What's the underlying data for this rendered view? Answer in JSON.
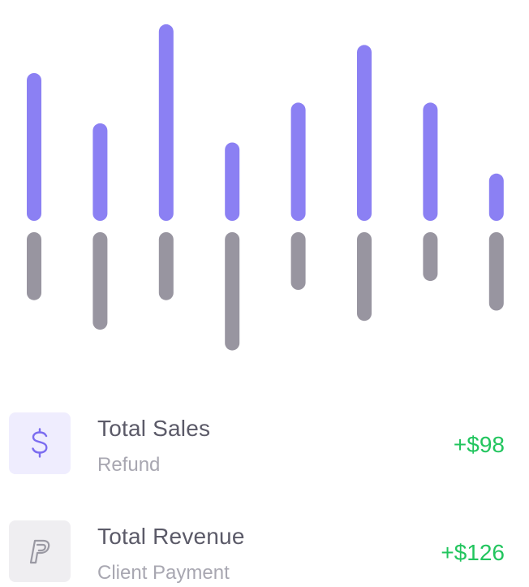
{
  "chart_data": {
    "type": "bar",
    "categories": [
      "",
      "",
      "",
      "",
      "",
      "",
      "",
      ""
    ],
    "series": [
      {
        "values": [
          100,
          66,
          133,
          53,
          80,
          119,
          80,
          32
        ],
        "color": "#8b80f3"
      },
      {
        "values": [
          -46,
          -66,
          -46,
          -80,
          -39,
          -60,
          -33,
          -53
        ],
        "color": "#9895a0"
      }
    ],
    "ylim": [
      -80,
      133
    ],
    "grid": false,
    "legend": "none"
  },
  "transactions": [
    {
      "title": "Total Sales",
      "subtitle": "Refund",
      "amount": "+$98",
      "icon": "dollar-icon",
      "icon_color": "#7b6cf0",
      "amount_color": "#22c55e"
    },
    {
      "title": "Total Revenue",
      "subtitle": "Client Payment",
      "amount": "+$126",
      "icon": "paypal-icon",
      "icon_color": "#9a99a3",
      "amount_color": "#22c55e"
    }
  ]
}
